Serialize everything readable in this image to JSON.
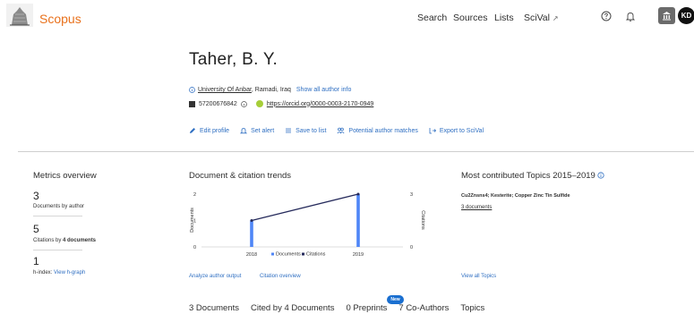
{
  "header": {
    "brand": "Scopus",
    "nav": {
      "search": "Search",
      "sources": "Sources",
      "lists": "Lists",
      "scival": "SciVal",
      "scival_ext": "↗"
    },
    "avatar_initials": "KD"
  },
  "author": {
    "name": "Taher, B. Y.",
    "affiliation": "University Of Anbar",
    "location": ", Ramadi, Iraq",
    "show_all": "Show all author info",
    "scopus_id": "57200676842",
    "orcid": "https://orcid.org/0000-0003-2170-0949"
  },
  "actions": {
    "edit_profile": "Edit profile",
    "set_alert": "Set alert",
    "save_to_list": "Save to list",
    "potential_matches": "Potential author matches",
    "export": "Export to SciVal"
  },
  "metrics": {
    "title": "Metrics overview",
    "documents_value": "3",
    "documents_label": "Documents by author",
    "citations_value": "5",
    "citations_label_pre": "Citations by ",
    "citations_label_bold": "4 documents",
    "hindex_value": "1",
    "hindex_label": "h-index:",
    "hgraph_link": "View h-graph"
  },
  "trends": {
    "title": "Document & citation trends",
    "analyze_link": "Analyze author output",
    "citation_overview_link": "Citation overview"
  },
  "chart_data": {
    "type": "bar",
    "categories": [
      "2018",
      "2019"
    ],
    "series": [
      {
        "name": "Documents",
        "values": [
          1,
          2
        ],
        "axis": "left",
        "kind": "bar",
        "color": "#4f86f7"
      },
      {
        "name": "Citations",
        "values": [
          1.5,
          3
        ],
        "axis": "right",
        "kind": "line",
        "color": "#262b5c"
      }
    ],
    "ylabel": "Documents",
    "y2label": "Citations",
    "ylim": [
      0,
      2
    ],
    "y2lim": [
      0,
      3
    ],
    "yticks": [
      "0",
      "1",
      "2"
    ],
    "y2ticks": [
      "0",
      "3"
    ],
    "legend": "bottom"
  },
  "topics": {
    "title": "Most contributed Topics 2015–2019",
    "topic": "Cu2Znsns4; Kesterite; Copper Zinc Tin Sulfide",
    "docs": "3 documents",
    "view_all": "View all Topics"
  },
  "tabs": {
    "documents": "3 Documents",
    "cited_by": "Cited by 4 Documents",
    "preprints": "0 Preprints",
    "new_badge": "New",
    "coauthors": "7 Co-Authors",
    "topics": "Topics"
  },
  "colors": {
    "brand": "#e9711c",
    "link": "#2f6fc2",
    "bar": "#4f86f7",
    "line": "#262b5c"
  }
}
